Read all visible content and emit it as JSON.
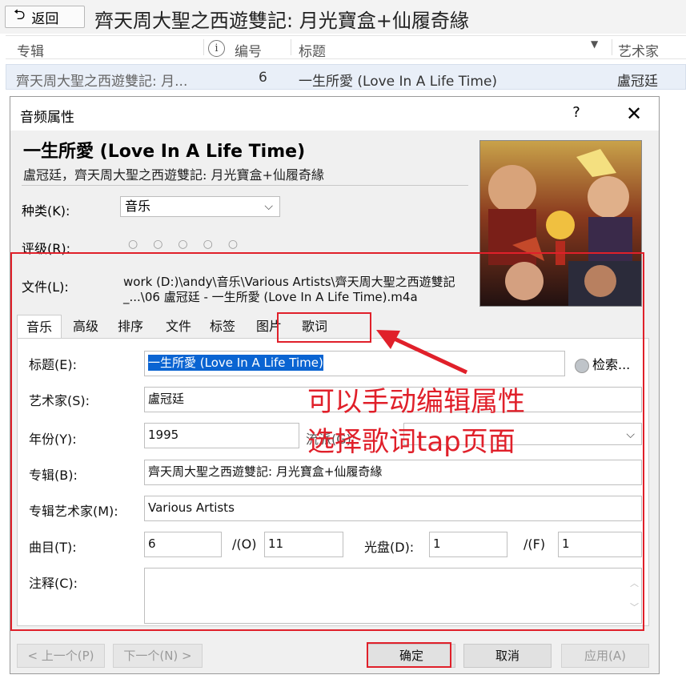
{
  "topbar": {
    "back_label": "返回",
    "title": "齊天周大聖之西遊雙記: 月光寶盒+仙履奇緣"
  },
  "columns": {
    "album": "专辑",
    "number": "编号",
    "title": "标题",
    "artist": "艺术家"
  },
  "row": {
    "album": "齊天周大聖之西遊雙記: 月...",
    "number": "6",
    "title": "一生所愛 (Love In A Life Time)",
    "artist": "盧冠廷"
  },
  "dialog": {
    "title": "音频属性",
    "help": "?",
    "close": "✕",
    "song_title": "一生所愛 (Love In A Life Time)",
    "song_subtitle": "盧冠廷，齊天周大聖之西遊雙記: 月光寶盒+仙履奇緣",
    "genre_label": "种类(K):",
    "genre_value": "音乐",
    "rating_label": "评级(R):",
    "rating_value": 0,
    "rating_max": 5,
    "file_label": "文件(L):",
    "file_path_line1": "work (D:)\\andy\\音乐\\Various Artists\\齊天周大聖之西遊雙記",
    "file_path_line2": "_...\\06 盧冠廷 - 一生所愛 (Love In A Life Time).m4a"
  },
  "tabs": [
    "音乐",
    "高级",
    "排序",
    "文件",
    "标签",
    "图片",
    "歌词"
  ],
  "active_tab": "音乐",
  "form": {
    "title_label": "标题(E):",
    "title_value": "一生所愛 (Love In A Life Time)",
    "search_label": "检索...",
    "artist_label": "艺术家(S):",
    "artist_value": "盧冠廷",
    "year_label": "年份(Y):",
    "year_value": "1995",
    "rating_label_hidden": "流派(G):",
    "album_label": "专辑(B):",
    "album_value": "齊天周大聖之西遊雙記: 月光寶盒+仙履奇緣",
    "album_artist_label": "专辑艺术家(M):",
    "album_artist_value": "Various Artists",
    "track_label": "曲目(T):",
    "track_value": "6",
    "track_of_label": "/(O)",
    "track_total": "11",
    "disc_label": "光盘(D):",
    "disc_value": "1",
    "disc_of_label": "/(F)",
    "disc_total": "1",
    "comment_label": "注释(C):",
    "comment_value": ""
  },
  "buttons": {
    "prev": "< 上一个(P)",
    "next": "下一个(N) >",
    "ok": "确定",
    "cancel": "取消",
    "apply": "应用(A)"
  },
  "annotation": {
    "line1": "可以手动编辑属性",
    "line2": "选择歌词tap页面",
    "color": "#e0202a"
  }
}
